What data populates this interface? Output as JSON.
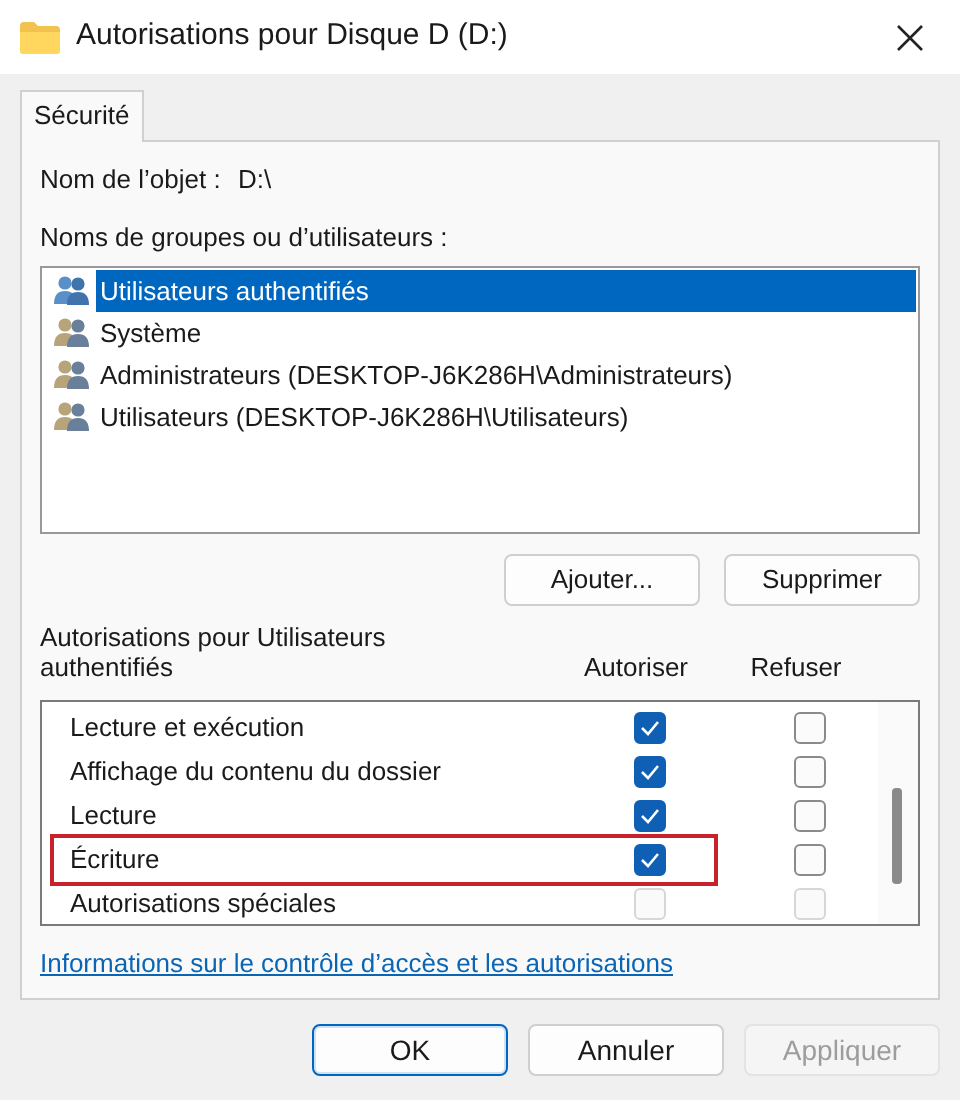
{
  "window": {
    "title": "Autorisations pour Disque D (D:)"
  },
  "tabs": [
    {
      "label": "Sécurité",
      "selected": true
    }
  ],
  "object_name": {
    "label": "Nom de l’objet :",
    "value": "D:\\"
  },
  "groups": {
    "label": "Noms de groupes ou d’utilisateurs :",
    "items": [
      {
        "name": "Utilisateurs authentifiés",
        "selected": true
      },
      {
        "name": "Système",
        "selected": false
      },
      {
        "name": "Administrateurs (DESKTOP-J6K286H\\Administrateurs)",
        "selected": false
      },
      {
        "name": "Utilisateurs (DESKTOP-J6K286H\\Utilisateurs)",
        "selected": false
      }
    ]
  },
  "group_buttons": [
    "Ajouter...",
    "Supprimer"
  ],
  "permissions": {
    "label": "Autorisations pour Utilisateurs authentifiés",
    "columns": [
      "Autoriser",
      "Refuser"
    ],
    "rows": [
      {
        "name": "Lecture et exécution",
        "allow": true,
        "deny": false,
        "disabled": false,
        "highlighted": false
      },
      {
        "name": "Affichage du contenu du dossier",
        "allow": true,
        "deny": false,
        "disabled": false,
        "highlighted": false
      },
      {
        "name": "Lecture",
        "allow": true,
        "deny": false,
        "disabled": false,
        "highlighted": false
      },
      {
        "name": "Écriture",
        "allow": true,
        "deny": false,
        "disabled": false,
        "highlighted": true
      },
      {
        "name": "Autorisations spéciales",
        "allow": false,
        "deny": false,
        "disabled": true,
        "highlighted": false
      }
    ]
  },
  "link": "Informations sur le contrôle d’accès et les autorisations",
  "buttons": [
    {
      "label": "OK",
      "default": true,
      "disabled": false
    },
    {
      "label": "Annuler",
      "default": false,
      "disabled": false
    },
    {
      "label": "Appliquer",
      "default": false,
      "disabled": true
    }
  ]
}
